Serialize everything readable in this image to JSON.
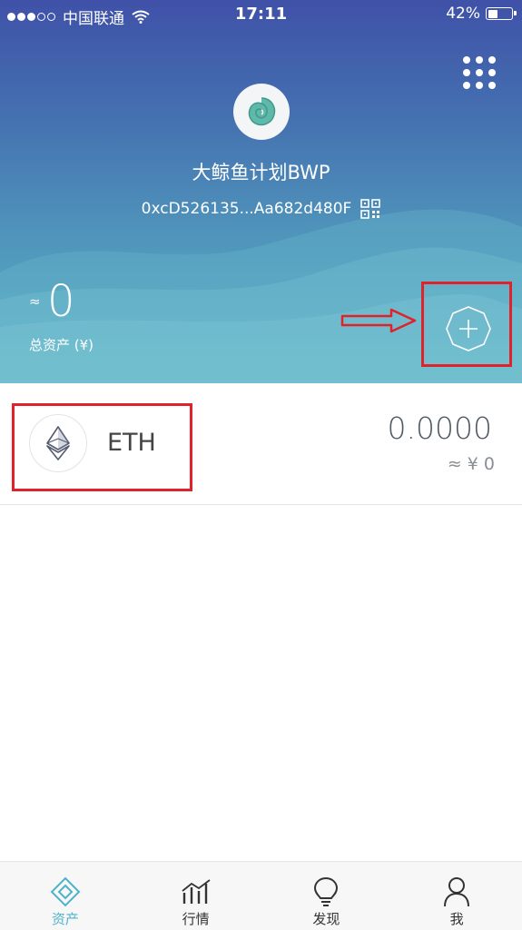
{
  "status_bar": {
    "carrier": "中国联通",
    "time": "17:11",
    "battery": "42%",
    "battery_level": 0.42
  },
  "wallet": {
    "name": "大鲸鱼计划BWP",
    "address": "0xcD526135...Aa682d480F"
  },
  "total": {
    "approx_symbol": "≈",
    "value": "0",
    "label": "总资产 (¥)"
  },
  "tokens": [
    {
      "symbol": "ETH",
      "balance": "0.0000",
      "fiat_value": "≈ ¥ 0"
    }
  ],
  "tabbar": {
    "items": [
      {
        "label": "资产",
        "icon": "assets-icon",
        "active": true
      },
      {
        "label": "行情",
        "icon": "market-chart-icon",
        "active": false
      },
      {
        "label": "发现",
        "icon": "lightbulb-icon",
        "active": false
      },
      {
        "label": "我",
        "icon": "profile-icon",
        "active": false
      }
    ]
  },
  "colors": {
    "header_top": "#3f51a8",
    "header_bottom": "#5cb4c6",
    "accent": "#4fb3c8",
    "annotation_red": "#e0222a"
  }
}
